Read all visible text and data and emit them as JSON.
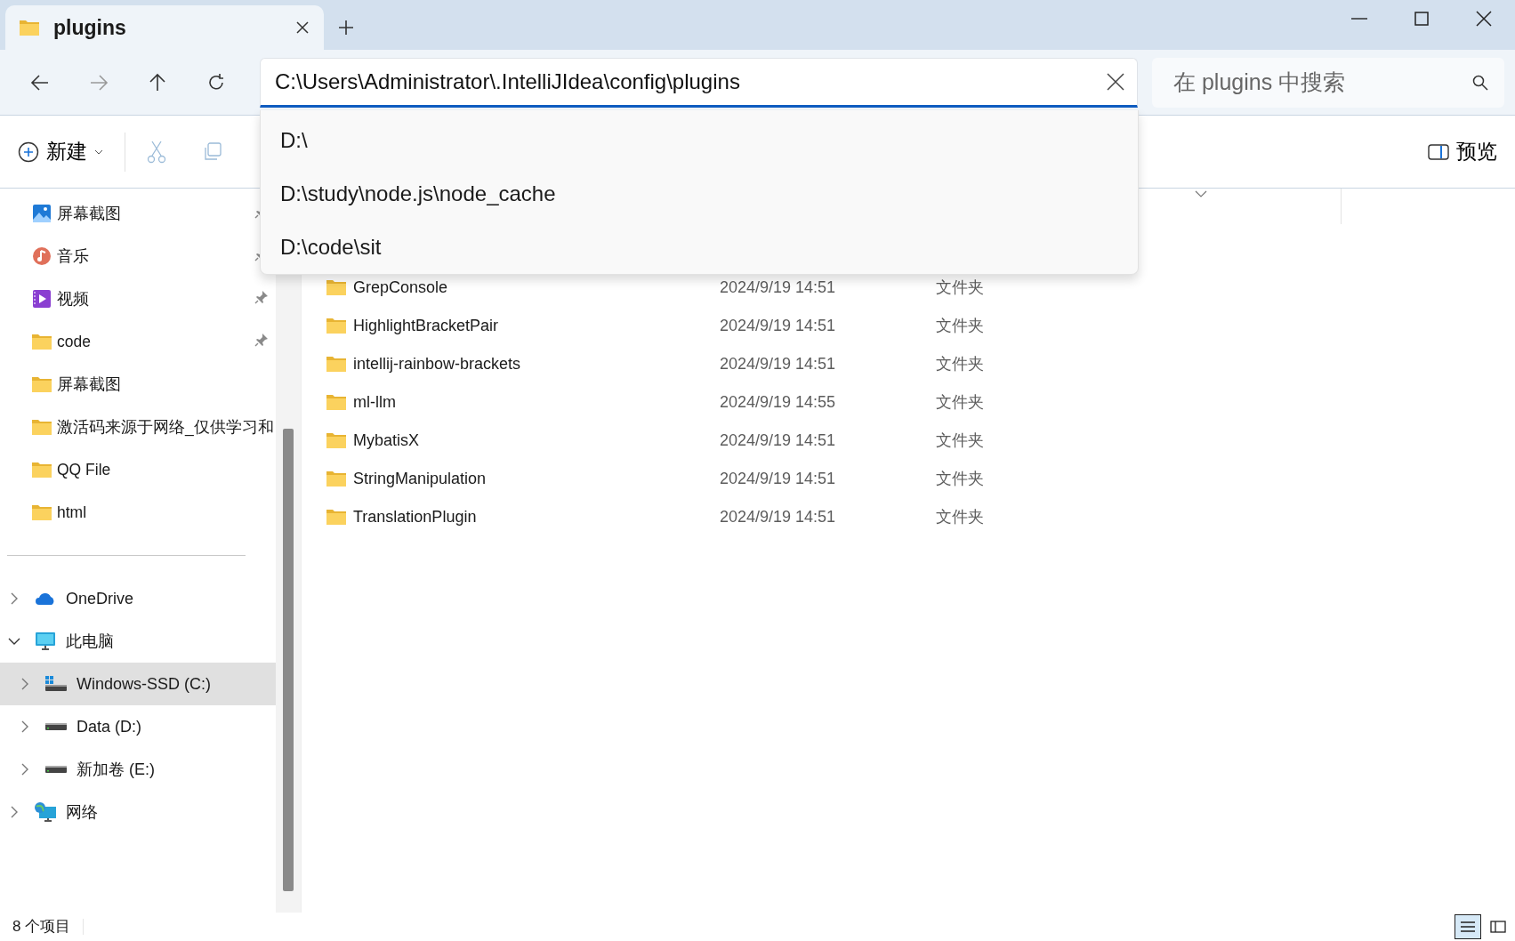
{
  "window": {
    "tab_title": "plugins"
  },
  "address_bar": {
    "value": "C:\\Users\\Administrator\\.IntelliJIdea\\config\\plugins"
  },
  "suggestions": [
    "D:\\",
    "D:\\study\\node.js\\node_cache",
    "D:\\code\\sit"
  ],
  "search": {
    "placeholder": "在 plugins 中搜索"
  },
  "toolbar": {
    "new_label": "新建",
    "preview_label": "预览"
  },
  "sidebar": {
    "quick_access": [
      {
        "label": "屏幕截图",
        "kind": "pictures",
        "pinned": true,
        "selected": false
      },
      {
        "label": "音乐",
        "kind": "music",
        "pinned": true,
        "selected": false
      },
      {
        "label": "视频",
        "kind": "videos",
        "pinned": true,
        "selected": false
      },
      {
        "label": "code",
        "kind": "folder",
        "pinned": true,
        "selected": false
      },
      {
        "label": "屏幕截图",
        "kind": "folder",
        "pinned": false,
        "selected": false
      },
      {
        "label": "激活码来源于网络_仅供学习和",
        "kind": "folder",
        "pinned": false,
        "selected": false
      },
      {
        "label": "QQ File",
        "kind": "folder",
        "pinned": false,
        "selected": false
      },
      {
        "label": "html",
        "kind": "folder",
        "pinned": false,
        "selected": false
      }
    ],
    "tree": [
      {
        "label": "OneDrive",
        "kind": "cloud",
        "expanded": false,
        "selected": false
      },
      {
        "label": "此电脑",
        "kind": "pc",
        "expanded": true,
        "selected": false,
        "children": [
          {
            "label": "Windows-SSD (C:)",
            "kind": "system-drive",
            "expanded": false,
            "selected": true
          },
          {
            "label": "Data (D:)",
            "kind": "drive",
            "expanded": false,
            "selected": false
          },
          {
            "label": "新加卷 (E:)",
            "kind": "drive",
            "expanded": false,
            "selected": false
          }
        ]
      },
      {
        "label": "网络",
        "kind": "network",
        "expanded": false,
        "selected": false
      }
    ]
  },
  "files": [
    {
      "name": "GrepConsole",
      "modified": "2024/9/19 14:51",
      "type": "文件夹"
    },
    {
      "name": "HighlightBracketPair",
      "modified": "2024/9/19 14:51",
      "type": "文件夹"
    },
    {
      "name": "intellij-rainbow-brackets",
      "modified": "2024/9/19 14:51",
      "type": "文件夹"
    },
    {
      "name": "ml-llm",
      "modified": "2024/9/19 14:55",
      "type": "文件夹"
    },
    {
      "name": "MybatisX",
      "modified": "2024/9/19 14:51",
      "type": "文件夹"
    },
    {
      "name": "StringManipulation",
      "modified": "2024/9/19 14:51",
      "type": "文件夹"
    },
    {
      "name": "TranslationPlugin",
      "modified": "2024/9/19 14:51",
      "type": "文件夹"
    }
  ],
  "status_bar": {
    "item_count": "8 个项目"
  },
  "view_buttons": [
    {
      "kind": "details",
      "selected": true
    },
    {
      "kind": "tiles",
      "selected": false
    }
  ]
}
